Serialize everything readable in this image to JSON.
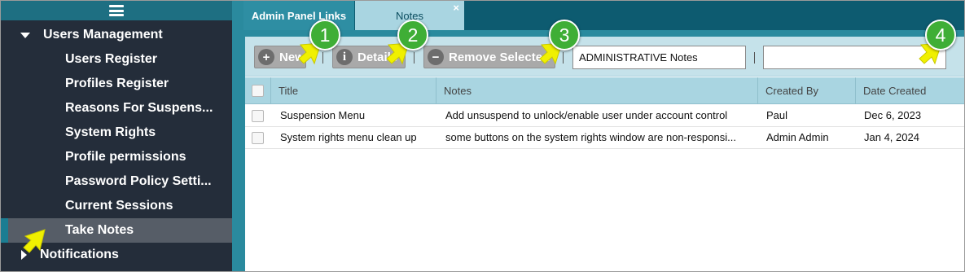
{
  "sidebar": {
    "menu_icon": "hamburger-icon",
    "group_users": "Users Management",
    "items": [
      {
        "label": "Users Register"
      },
      {
        "label": "Profiles Register"
      },
      {
        "label": "Reasons For Suspens..."
      },
      {
        "label": "System Rights"
      },
      {
        "label": "Profile permissions"
      },
      {
        "label": "Password Policy Setti..."
      },
      {
        "label": "Current Sessions"
      },
      {
        "label": "Take Notes"
      }
    ],
    "group_notifications": "Notifications"
  },
  "tabs": {
    "admin_panel_links": "Admin Panel Links",
    "notes": "Notes",
    "close_glyph": "×"
  },
  "toolbar": {
    "new_label": "New",
    "details_label": "Details",
    "remove_label": "Remove Selected",
    "filter_value": "ADMINISTRATIVE Notes",
    "search_value": ""
  },
  "grid": {
    "columns": [
      "Title",
      "Notes",
      "Created By",
      "Date Created"
    ],
    "rows": [
      {
        "title": "Suspension Menu",
        "notes": "Add unsuspend to unlock/enable user under account control",
        "created_by": "Paul",
        "date_created": "Dec 6, 2023"
      },
      {
        "title": "System rights menu clean up",
        "notes": "some buttons on the system rights window are non-responsi...",
        "created_by": "Admin Admin",
        "date_created": "Jan 4, 2024"
      }
    ]
  },
  "callouts": [
    "1",
    "2",
    "3",
    "4"
  ],
  "colors": {
    "sidebar_bg": "#242d3a",
    "accent_teal": "#2a8a9e",
    "tabbar_bg": "#0d5b70",
    "header_bg": "#a9d5e1",
    "callout_green": "#3fae36",
    "pointer_yellow": "#f0f000"
  }
}
